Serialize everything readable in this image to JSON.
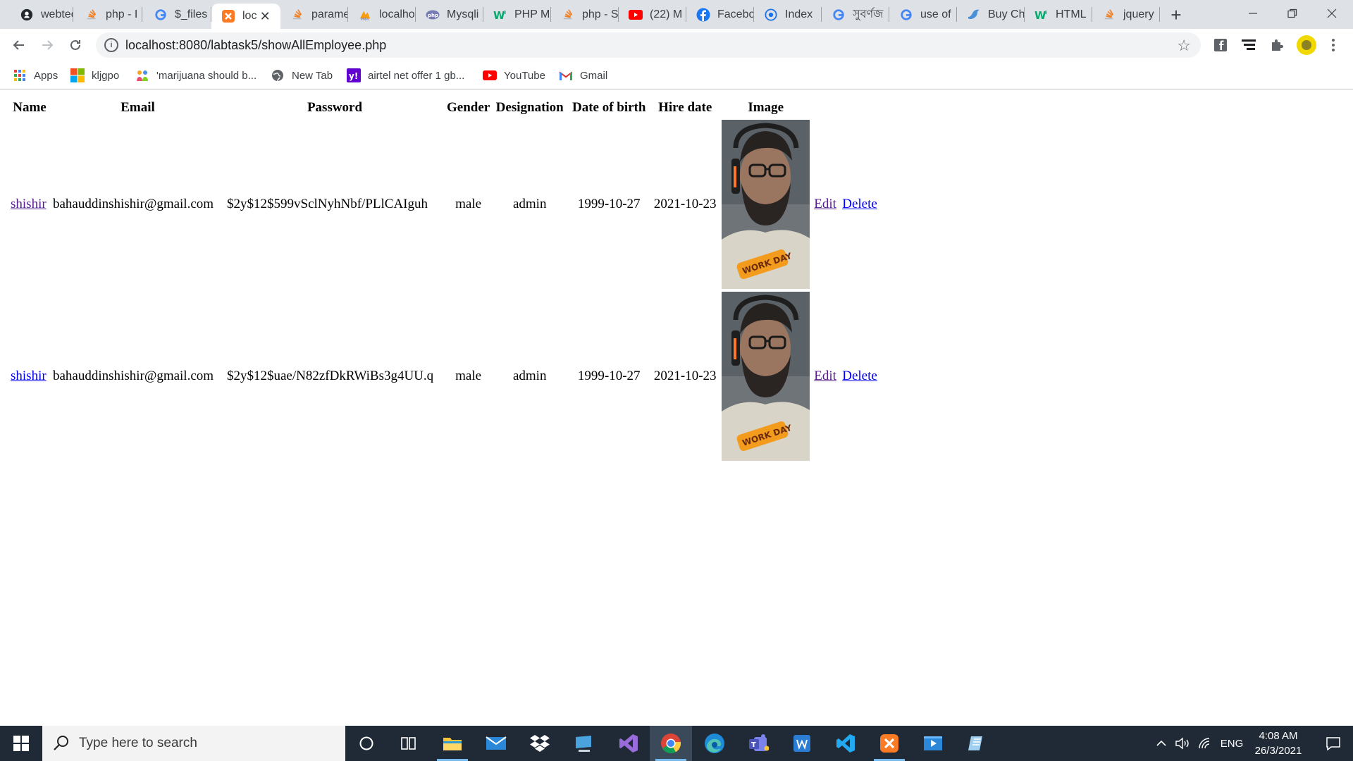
{
  "browser": {
    "tabs": [
      {
        "title": "webtec",
        "icon": "github-icon"
      },
      {
        "title": "php - I",
        "icon": "stackoverflow-icon"
      },
      {
        "title": "$_files",
        "icon": "google-icon"
      },
      {
        "title": "loc",
        "icon": "xampp-icon",
        "active": true
      },
      {
        "title": "parame",
        "icon": "stackoverflow-icon"
      },
      {
        "title": "localho",
        "icon": "phpmyadmin-icon"
      },
      {
        "title": "Mysqli",
        "icon": "php-icon"
      },
      {
        "title": "PHP M",
        "icon": "w3schools-icon"
      },
      {
        "title": "php - S",
        "icon": "stackoverflow-icon"
      },
      {
        "title": "(22) M",
        "icon": "youtube-icon"
      },
      {
        "title": "Facebo",
        "icon": "facebook-icon"
      },
      {
        "title": "Index",
        "icon": "globe-icon"
      },
      {
        "title": "সুবর্ণজ",
        "icon": "google-icon"
      },
      {
        "title": "use of",
        "icon": "google-icon"
      },
      {
        "title": "Buy Ch",
        "icon": "bird-icon"
      },
      {
        "title": "HTML",
        "icon": "w3schools-icon"
      },
      {
        "title": "jquery",
        "icon": "stackoverflow-icon"
      }
    ],
    "url": "localhost:8080/labtask5/showAllEmployee.php",
    "bookmarks": [
      {
        "label": "Apps",
        "icon": "apps-grid-icon"
      },
      {
        "label": "kljgpo",
        "icon": "windows-logo-icon"
      },
      {
        "label": "'marijuana should b...",
        "icon": "crowd-icon"
      },
      {
        "label": "New Tab",
        "icon": "globe-icon"
      },
      {
        "label": "airtel net offer 1 gb...",
        "icon": "yahoo-icon"
      },
      {
        "label": "YouTube",
        "icon": "youtube-icon"
      },
      {
        "label": "Gmail",
        "icon": "gmail-icon"
      }
    ]
  },
  "table": {
    "headers": [
      "Name",
      "Email",
      "Password",
      "Gender",
      "Designation",
      "Date of birth",
      "Hire date",
      "Image"
    ],
    "rows": [
      {
        "name": "shishir",
        "email": "bahauddinshishir@gmail.com",
        "password": "$2y$12$599vSclNyhNbf/PLlCAIguh",
        "gender": "male",
        "designation": "admin",
        "dob": "1999-10-27",
        "hire_date": "2021-10-23",
        "edit": "Edit",
        "delete": "Delete"
      },
      {
        "name": "shishir",
        "email": "bahauddinshishir@gmail.com",
        "password": "$2y$12$uae/N82zfDkRWiBs3g4UU.q",
        "gender": "male",
        "designation": "admin",
        "dob": "1999-10-27",
        "hire_date": "2021-10-23",
        "edit": "Edit",
        "delete": "Delete"
      }
    ]
  },
  "taskbar": {
    "search_placeholder": "Type here to search",
    "language": "ENG",
    "time": "4:08 AM",
    "date": "26/3/2021"
  },
  "colors": {
    "link": "#0000ee",
    "visited_link": "#551a8b",
    "taskbar_bg": "#1f2a36",
    "tabstrip_bg": "#dee1e6"
  }
}
